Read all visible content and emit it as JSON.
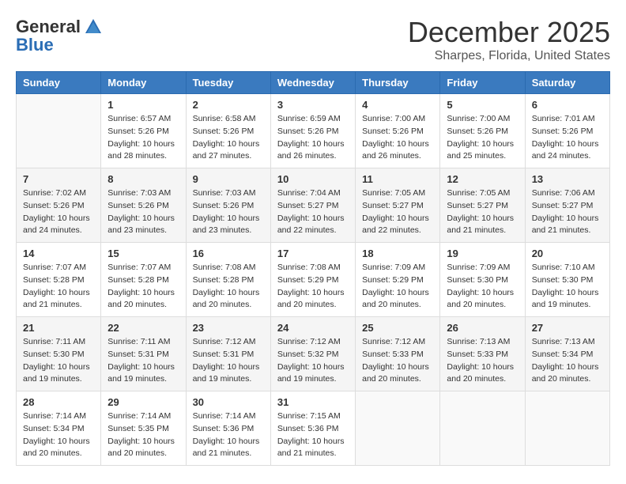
{
  "header": {
    "logo_general": "General",
    "logo_blue": "Blue",
    "month_title": "December 2025",
    "location": "Sharpes, Florida, United States"
  },
  "weekdays": [
    "Sunday",
    "Monday",
    "Tuesday",
    "Wednesday",
    "Thursday",
    "Friday",
    "Saturday"
  ],
  "weeks": [
    [
      {
        "day": "",
        "sunrise": "",
        "sunset": "",
        "daylight": "",
        "empty": true
      },
      {
        "day": "1",
        "sunrise": "6:57 AM",
        "sunset": "5:26 PM",
        "daylight": "10 hours and 28 minutes."
      },
      {
        "day": "2",
        "sunrise": "6:58 AM",
        "sunset": "5:26 PM",
        "daylight": "10 hours and 27 minutes."
      },
      {
        "day": "3",
        "sunrise": "6:59 AM",
        "sunset": "5:26 PM",
        "daylight": "10 hours and 26 minutes."
      },
      {
        "day": "4",
        "sunrise": "7:00 AM",
        "sunset": "5:26 PM",
        "daylight": "10 hours and 26 minutes."
      },
      {
        "day": "5",
        "sunrise": "7:00 AM",
        "sunset": "5:26 PM",
        "daylight": "10 hours and 25 minutes."
      },
      {
        "day": "6",
        "sunrise": "7:01 AM",
        "sunset": "5:26 PM",
        "daylight": "10 hours and 24 minutes."
      }
    ],
    [
      {
        "day": "7",
        "sunrise": "7:02 AM",
        "sunset": "5:26 PM",
        "daylight": "10 hours and 24 minutes."
      },
      {
        "day": "8",
        "sunrise": "7:03 AM",
        "sunset": "5:26 PM",
        "daylight": "10 hours and 23 minutes."
      },
      {
        "day": "9",
        "sunrise": "7:03 AM",
        "sunset": "5:26 PM",
        "daylight": "10 hours and 23 minutes."
      },
      {
        "day": "10",
        "sunrise": "7:04 AM",
        "sunset": "5:27 PM",
        "daylight": "10 hours and 22 minutes."
      },
      {
        "day": "11",
        "sunrise": "7:05 AM",
        "sunset": "5:27 PM",
        "daylight": "10 hours and 22 minutes."
      },
      {
        "day": "12",
        "sunrise": "7:05 AM",
        "sunset": "5:27 PM",
        "daylight": "10 hours and 21 minutes."
      },
      {
        "day": "13",
        "sunrise": "7:06 AM",
        "sunset": "5:27 PM",
        "daylight": "10 hours and 21 minutes."
      }
    ],
    [
      {
        "day": "14",
        "sunrise": "7:07 AM",
        "sunset": "5:28 PM",
        "daylight": "10 hours and 21 minutes."
      },
      {
        "day": "15",
        "sunrise": "7:07 AM",
        "sunset": "5:28 PM",
        "daylight": "10 hours and 20 minutes."
      },
      {
        "day": "16",
        "sunrise": "7:08 AM",
        "sunset": "5:28 PM",
        "daylight": "10 hours and 20 minutes."
      },
      {
        "day": "17",
        "sunrise": "7:08 AM",
        "sunset": "5:29 PM",
        "daylight": "10 hours and 20 minutes."
      },
      {
        "day": "18",
        "sunrise": "7:09 AM",
        "sunset": "5:29 PM",
        "daylight": "10 hours and 20 minutes."
      },
      {
        "day": "19",
        "sunrise": "7:09 AM",
        "sunset": "5:30 PM",
        "daylight": "10 hours and 20 minutes."
      },
      {
        "day": "20",
        "sunrise": "7:10 AM",
        "sunset": "5:30 PM",
        "daylight": "10 hours and 19 minutes."
      }
    ],
    [
      {
        "day": "21",
        "sunrise": "7:11 AM",
        "sunset": "5:30 PM",
        "daylight": "10 hours and 19 minutes."
      },
      {
        "day": "22",
        "sunrise": "7:11 AM",
        "sunset": "5:31 PM",
        "daylight": "10 hours and 19 minutes."
      },
      {
        "day": "23",
        "sunrise": "7:12 AM",
        "sunset": "5:31 PM",
        "daylight": "10 hours and 19 minutes."
      },
      {
        "day": "24",
        "sunrise": "7:12 AM",
        "sunset": "5:32 PM",
        "daylight": "10 hours and 19 minutes."
      },
      {
        "day": "25",
        "sunrise": "7:12 AM",
        "sunset": "5:33 PM",
        "daylight": "10 hours and 20 minutes."
      },
      {
        "day": "26",
        "sunrise": "7:13 AM",
        "sunset": "5:33 PM",
        "daylight": "10 hours and 20 minutes."
      },
      {
        "day": "27",
        "sunrise": "7:13 AM",
        "sunset": "5:34 PM",
        "daylight": "10 hours and 20 minutes."
      }
    ],
    [
      {
        "day": "28",
        "sunrise": "7:14 AM",
        "sunset": "5:34 PM",
        "daylight": "10 hours and 20 minutes."
      },
      {
        "day": "29",
        "sunrise": "7:14 AM",
        "sunset": "5:35 PM",
        "daylight": "10 hours and 20 minutes."
      },
      {
        "day": "30",
        "sunrise": "7:14 AM",
        "sunset": "5:36 PM",
        "daylight": "10 hours and 21 minutes."
      },
      {
        "day": "31",
        "sunrise": "7:15 AM",
        "sunset": "5:36 PM",
        "daylight": "10 hours and 21 minutes."
      },
      {
        "day": "",
        "sunrise": "",
        "sunset": "",
        "daylight": "",
        "empty": true
      },
      {
        "day": "",
        "sunrise": "",
        "sunset": "",
        "daylight": "",
        "empty": true
      },
      {
        "day": "",
        "sunrise": "",
        "sunset": "",
        "daylight": "",
        "empty": true
      }
    ]
  ],
  "labels": {
    "sunrise_prefix": "Sunrise: ",
    "sunset_prefix": "Sunset: ",
    "daylight_prefix": "Daylight: "
  }
}
